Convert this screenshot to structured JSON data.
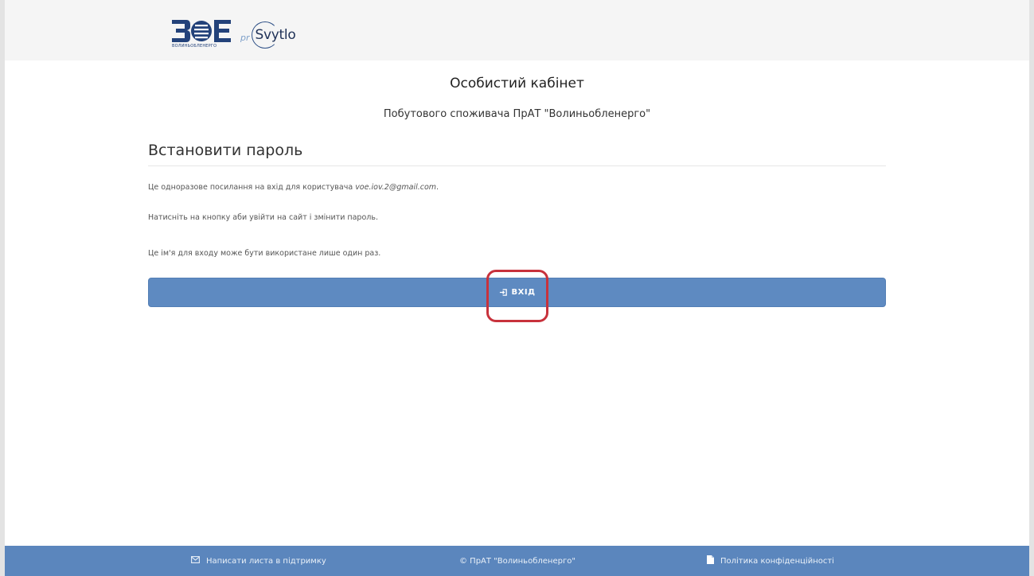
{
  "header": {
    "brand_logo_text": "ВОЕ",
    "brand_logo_subtitle": "ВОЛИНЬОБЛЕНЕРГО",
    "partner_prefix": "pr",
    "partner_name": "Svytlo"
  },
  "page": {
    "title": "Особистий кабінет",
    "subtitle": "Побутового споживача ПрАТ \"Волиньобленерго\""
  },
  "form": {
    "heading": "Встановити пароль",
    "paragraph1_prefix": "Це одноразове посилання на вхід для користувача ",
    "paragraph1_email": "voe.iov.2@gmail.com",
    "paragraph1_suffix": ".",
    "paragraph2": "Натисніть на кнопку аби увійти на сайт і змінити пароль.",
    "paragraph3": "Це ім'я для входу може бути використане лише один раз.",
    "login_button_label": "ВХІД",
    "login_button_icon": "sign-in-icon",
    "highlight_color": "#c8323c",
    "button_color": "#5e8ac1"
  },
  "footer": {
    "support_label": "Написати листа в підтримку",
    "support_icon": "envelope-icon",
    "copyright": "© ПрАТ \"Волиньобленерго\"",
    "policy_label": "Політика конфіденційності",
    "policy_icon": "document-icon",
    "background_color": "#5b86bd"
  }
}
